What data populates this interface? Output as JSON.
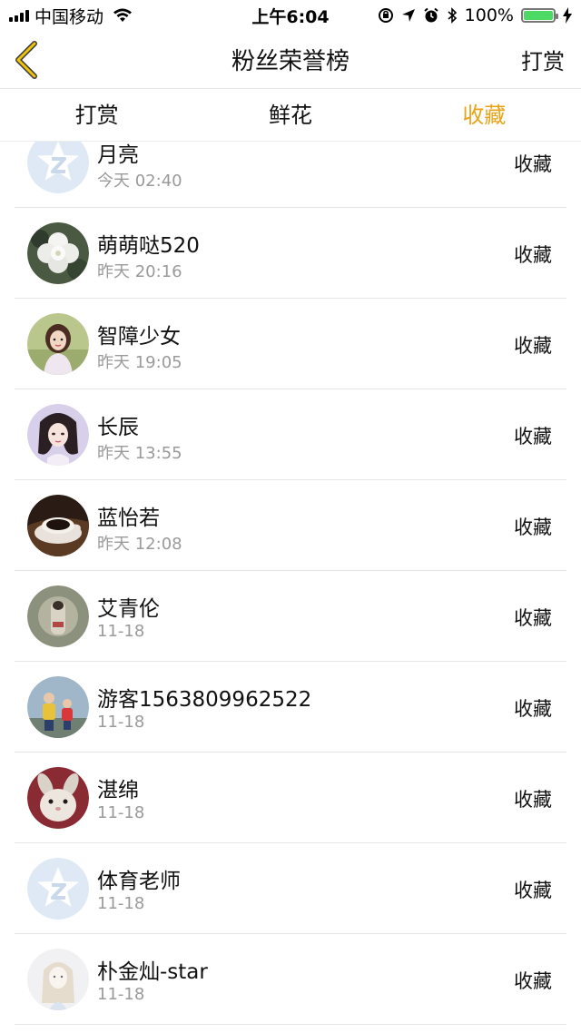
{
  "status_bar": {
    "carrier": "中国移动",
    "time": "上午6:04",
    "battery_percent": "100%",
    "battery_level": 1.0,
    "icons": [
      "signal-icon",
      "wifi-icon",
      "lock-rotation-icon",
      "location-icon",
      "alarm-icon",
      "bluetooth-icon",
      "battery-icon",
      "charging-icon"
    ]
  },
  "nav": {
    "back_icon": "chevron-left-icon",
    "title": "粉丝荣誉榜",
    "right_label": "打赏",
    "accent_color": "#e8a318"
  },
  "tabs": [
    {
      "label": "打赏",
      "active": false
    },
    {
      "label": "鲜花",
      "active": false
    },
    {
      "label": "收藏",
      "active": true
    }
  ],
  "rows": [
    {
      "name": "月亮",
      "time": "今天 02:40",
      "action": "收藏",
      "avatar": "default-star-avatar"
    },
    {
      "name": "萌萌哒520",
      "time": "昨天 20:16",
      "action": "收藏",
      "avatar": "flower-avatar"
    },
    {
      "name": "智障少女",
      "time": "昨天 19:05",
      "action": "收藏",
      "avatar": "girl-avatar"
    },
    {
      "name": "长辰",
      "time": "昨天 13:55",
      "action": "收藏",
      "avatar": "anime-girl-avatar"
    },
    {
      "name": "蓝怡若",
      "time": "昨天 12:08",
      "action": "收藏",
      "avatar": "coffee-avatar"
    },
    {
      "name": "艾青伦",
      "time": "11-18",
      "action": "收藏",
      "avatar": "painting-avatar"
    },
    {
      "name": "游客1563809962522",
      "time": "11-18",
      "action": "收藏",
      "avatar": "kids-avatar"
    },
    {
      "name": "湛绵",
      "time": "11-18",
      "action": "收藏",
      "avatar": "rabbit-avatar"
    },
    {
      "name": "体育老师",
      "time": "11-18",
      "action": "收藏",
      "avatar": "default-star-avatar"
    },
    {
      "name": "朴金灿-star",
      "time": "11-18",
      "action": "收藏",
      "avatar": "sketch-girl-avatar"
    }
  ]
}
